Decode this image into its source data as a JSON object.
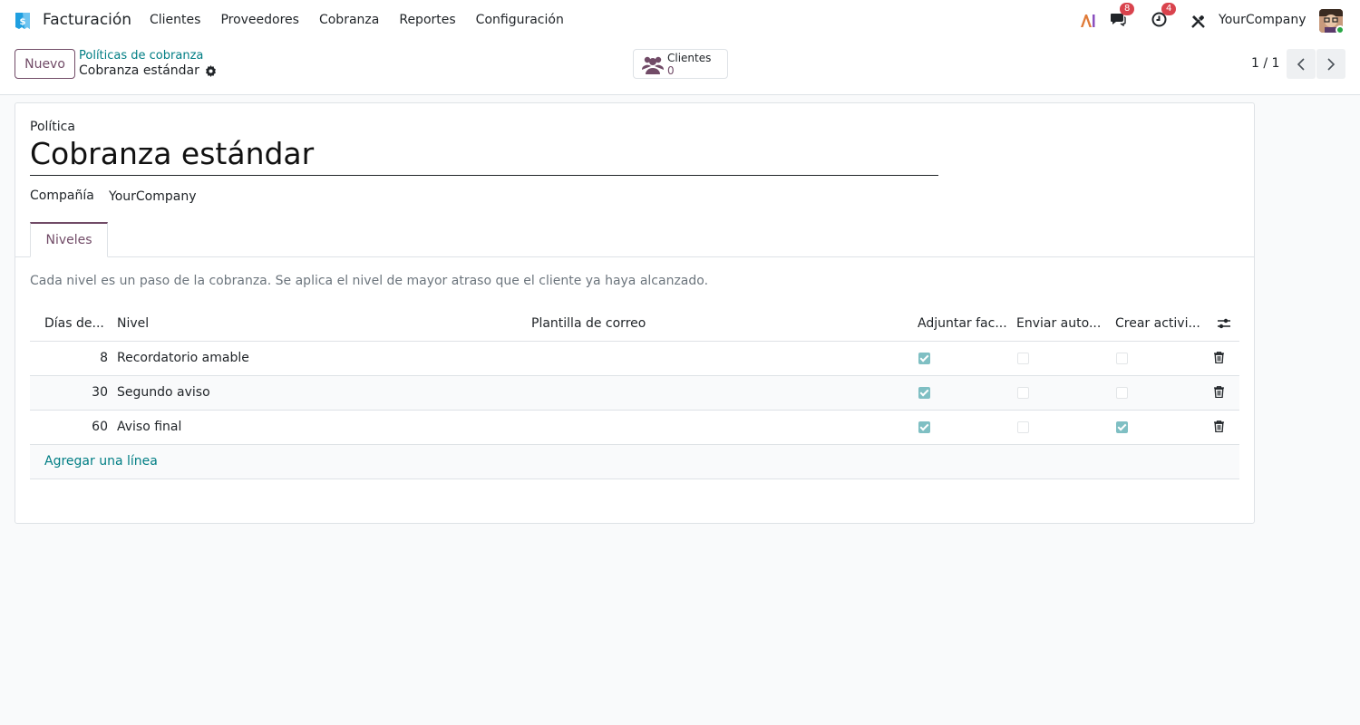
{
  "navbar": {
    "app_name": "Facturación",
    "menu": [
      "Clientes",
      "Proveedores",
      "Cobranza",
      "Reportes",
      "Configuración"
    ],
    "messages_count": "8",
    "activities_count": "4",
    "company": "YourCompany"
  },
  "control": {
    "new_label": "Nuevo",
    "breadcrumb_parent": "Políticas de cobranza",
    "breadcrumb_current": "Cobranza estándar",
    "stat_label": "Clientes",
    "stat_value": "0",
    "pager": "1 / 1"
  },
  "form": {
    "policy_label": "Política",
    "title": "Cobranza estándar",
    "company_label": "Compañía",
    "company_value": "YourCompany",
    "tab_label": "Niveles",
    "description": "Cada nivel es un paso de la cobranza. Se aplica el nivel de mayor atraso que el cliente ya haya alcanzado."
  },
  "table": {
    "headers": {
      "days": "Días de...",
      "level": "Nivel",
      "template": "Plantilla de correo",
      "attach": "Adjuntar fac...",
      "send": "Enviar auto...",
      "activity": "Crear activi..."
    },
    "rows": [
      {
        "days": "8",
        "level": "Recordatorio amable",
        "attach": true,
        "send": false,
        "activity": false
      },
      {
        "days": "30",
        "level": "Segundo aviso",
        "attach": true,
        "send": false,
        "activity": false
      },
      {
        "days": "60",
        "level": "Aviso final",
        "attach": true,
        "send": false,
        "activity": true
      }
    ],
    "add_line": "Agregar una línea"
  },
  "colors": {
    "brand": "#714b67",
    "link": "#017e84",
    "checkbox_on": "#7fbfc3"
  }
}
